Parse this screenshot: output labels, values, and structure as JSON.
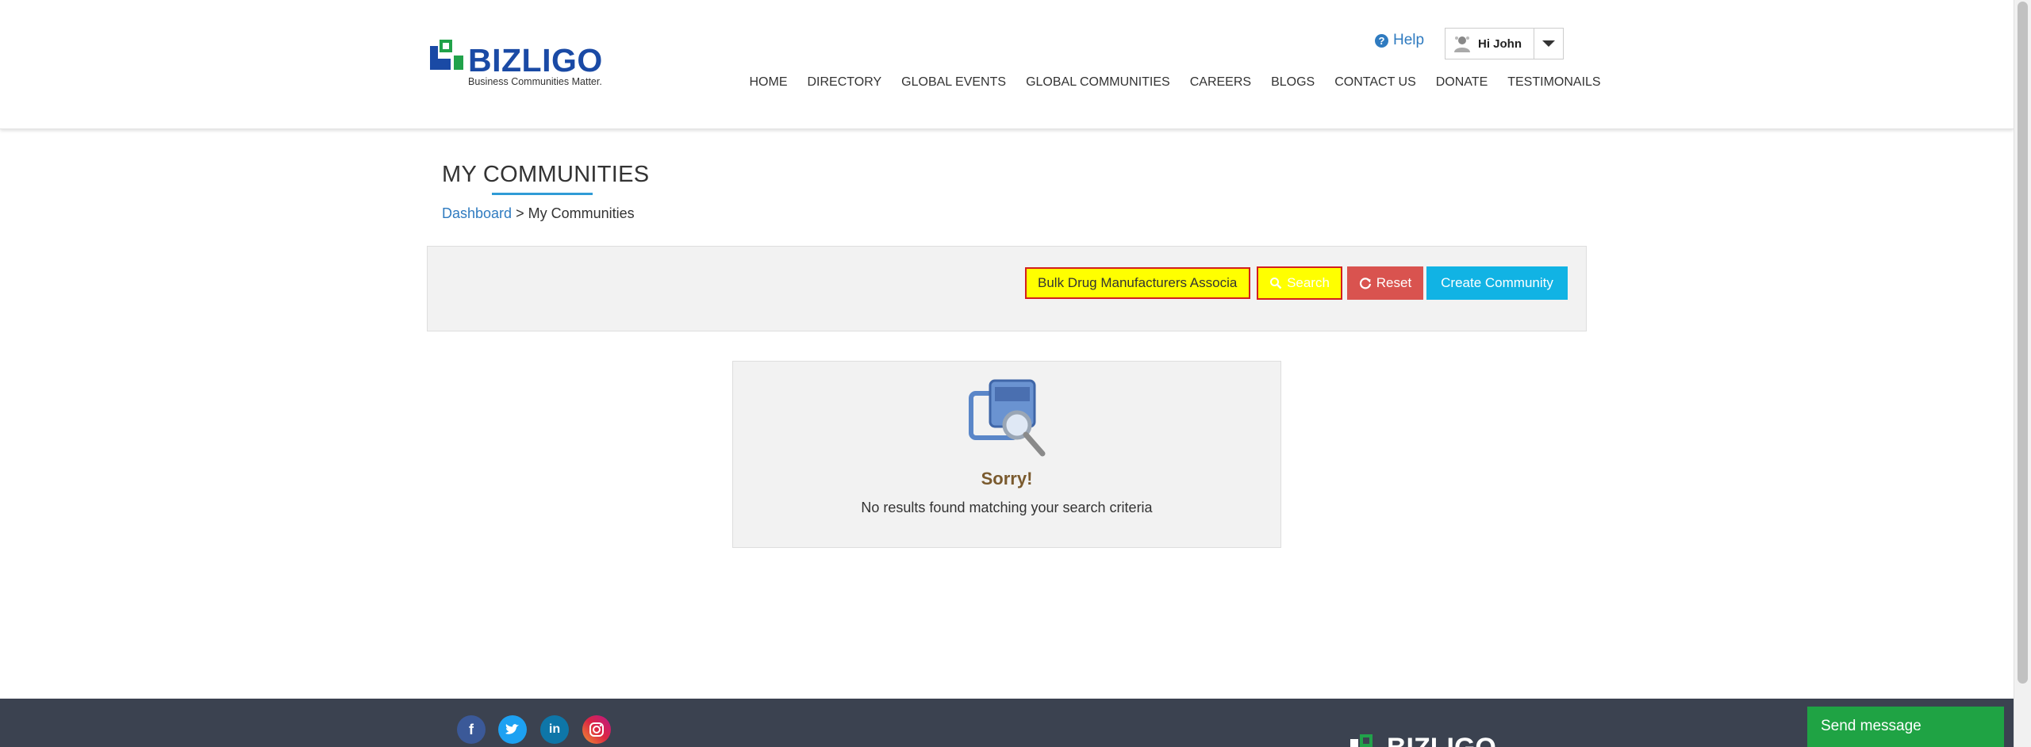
{
  "header": {
    "logo": {
      "name": "BIZLIGO",
      "tagline": "Business Communities Matter."
    },
    "help_label": "Help",
    "user_greeting": "Hi John",
    "nav": [
      "HOME",
      "DIRECTORY",
      "GLOBAL EVENTS",
      "GLOBAL COMMUNITIES",
      "CAREERS",
      "BLOGS",
      "CONTACT US",
      "DONATE",
      "TESTIMONAILS"
    ]
  },
  "page": {
    "title": "MY COMMUNITIES",
    "breadcrumb": {
      "link": "Dashboard",
      "separator": ">",
      "current": "My Communities"
    }
  },
  "search": {
    "value": "Bulk Drug Manufacturers Associa",
    "search_label": "Search",
    "reset_label": "Reset",
    "create_label": "Create Community"
  },
  "results": {
    "heading": "Sorry!",
    "message": "No results found matching your search criteria"
  },
  "footer": {
    "social": [
      "facebook",
      "twitter",
      "linkedin",
      "instagram"
    ],
    "social_glyphs": {
      "facebook": "f",
      "linkedin": "in"
    },
    "send_message": "Send message"
  },
  "colors": {
    "brand_blue": "#1a4aa5",
    "brand_green": "#1fa344",
    "highlight": "#ffff00",
    "reset": "#d9534f",
    "create": "#11b3e4"
  }
}
